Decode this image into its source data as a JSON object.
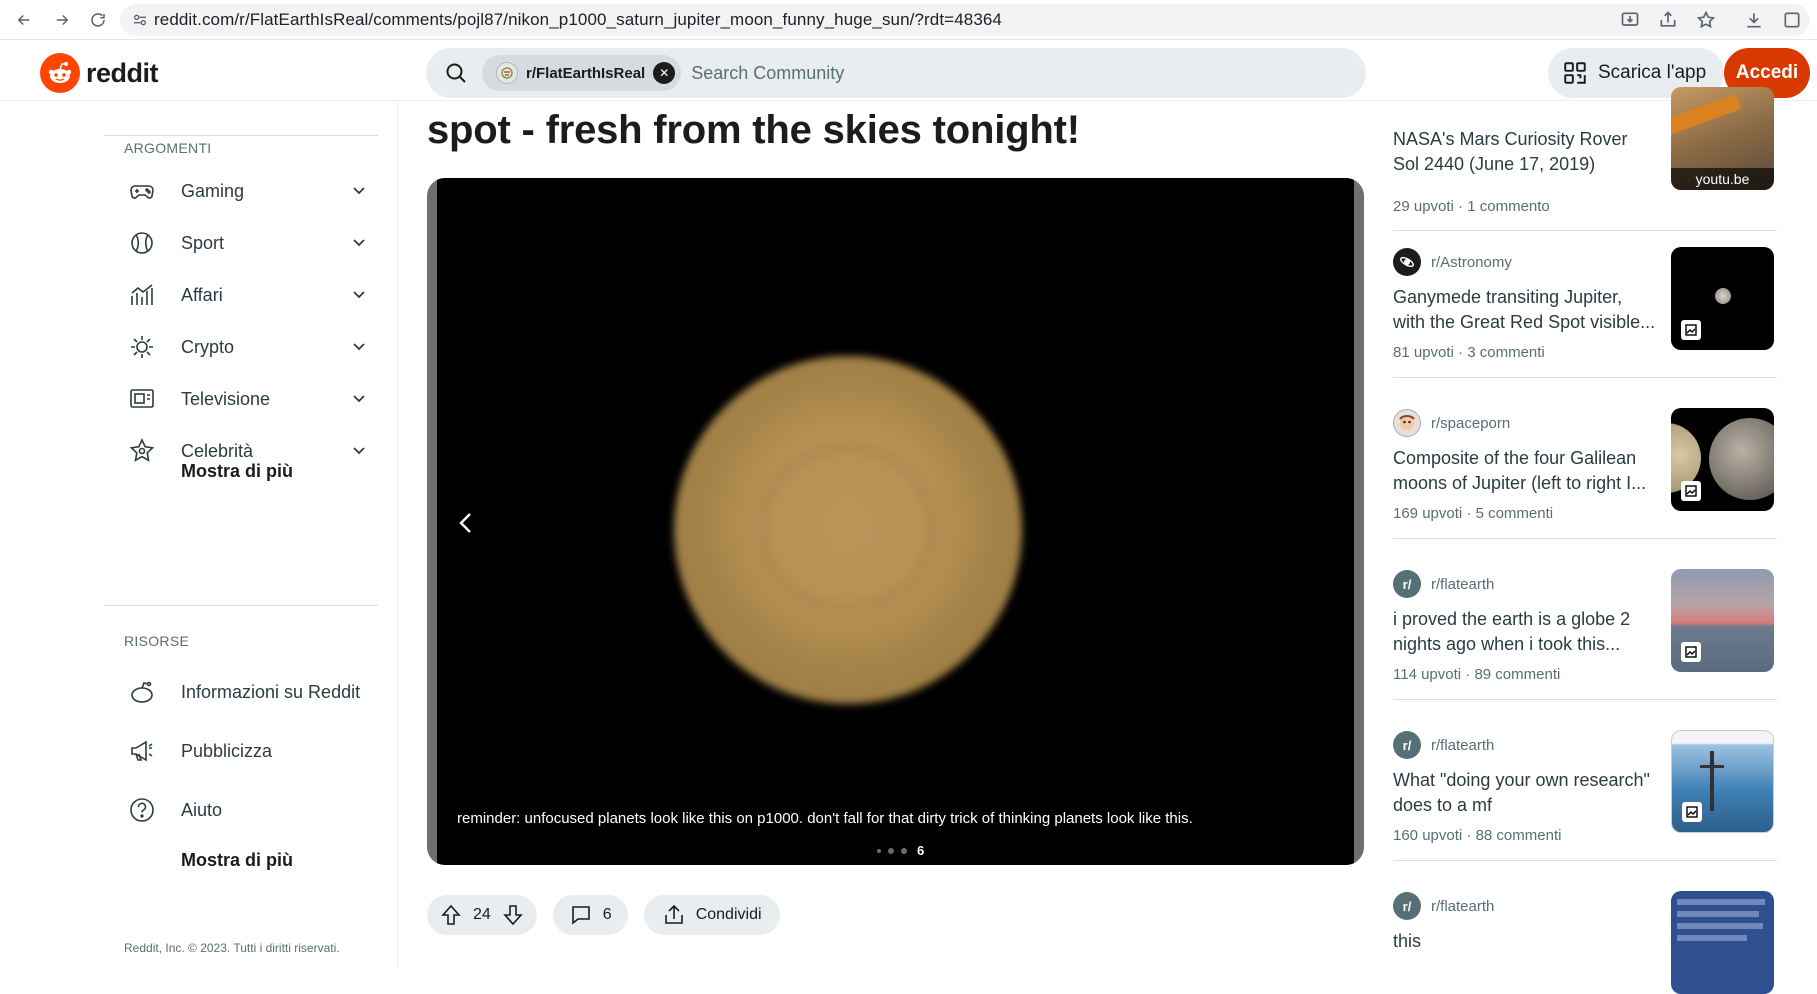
{
  "browser": {
    "url": "reddit.com/r/FlatEarthIsReal/comments/pojl87/nikon_p1000_saturn_jupiter_moon_funny_huge_sun/?rdt=48364"
  },
  "header": {
    "logo_text": "reddit",
    "chip_label": "r/FlatEarthIsReal",
    "search_placeholder": "Search Community",
    "app_button": "Scarica l'app",
    "login_button": "Accedi",
    "brand_color": "#ff4500",
    "login_color": "#d93900"
  },
  "sidebar": {
    "topics_title": "ARGOMENTI",
    "topics": [
      {
        "label": "Gaming",
        "icon": "gamepad-icon"
      },
      {
        "label": "Sport",
        "icon": "ball-icon"
      },
      {
        "label": "Affari",
        "icon": "chart-icon"
      },
      {
        "label": "Crypto",
        "icon": "crypto-icon"
      },
      {
        "label": "Televisione",
        "icon": "tv-icon"
      },
      {
        "label": "Celebrità",
        "icon": "star-icon"
      }
    ],
    "topics_more": "Mostra di più",
    "resources_title": "RISORSE",
    "resources": [
      {
        "label": "Informazioni su Reddit",
        "icon": "reddit-icon"
      },
      {
        "label": "Pubblicizza",
        "icon": "megaphone-icon"
      },
      {
        "label": "Aiuto",
        "icon": "help-icon"
      }
    ],
    "resources_more": "Mostra di più",
    "copyright": "Reddit, Inc. © 2023. Tutti i diritti riservati."
  },
  "post": {
    "title_fragment": "spot - fresh from the skies tonight!",
    "caption": "reminder: unfocused planets look like this on p1000. don't fall for that dirty trick of thinking planets look like this.",
    "gallery_index": "6",
    "upvotes": "24",
    "comments": "6",
    "share_label": "Condividi"
  },
  "related": [
    {
      "subreddit": "",
      "title": "NASA's Mars Curiosity Rover Sol 2440 (June 17, 2019)",
      "meta_upvotes": "29 upvoti",
      "meta_comments": "1 commento",
      "thumb_label": "youtu.be"
    },
    {
      "subreddit": "r/Astronomy",
      "title": "Ganymede transiting Jupiter, with the Great Red Spot visible...",
      "meta_upvotes": "81 upvoti",
      "meta_comments": "3 commenti"
    },
    {
      "subreddit": "r/spaceporn",
      "title": "Composite of the four Galilean moons of Jupiter (left to right I...",
      "meta_upvotes": "169 upvoti",
      "meta_comments": "5 commenti"
    },
    {
      "subreddit": "r/flatearth",
      "title": "i proved the earth is a globe 2 nights ago when i took this...",
      "meta_upvotes": "114 upvoti",
      "meta_comments": "89 commenti"
    },
    {
      "subreddit": "r/flatearth",
      "title": "What \"doing your own research\" does to a mf",
      "meta_upvotes": "160 upvoti",
      "meta_comments": "88 commenti"
    },
    {
      "subreddit": "r/flatearth",
      "title": "this"
    }
  ]
}
